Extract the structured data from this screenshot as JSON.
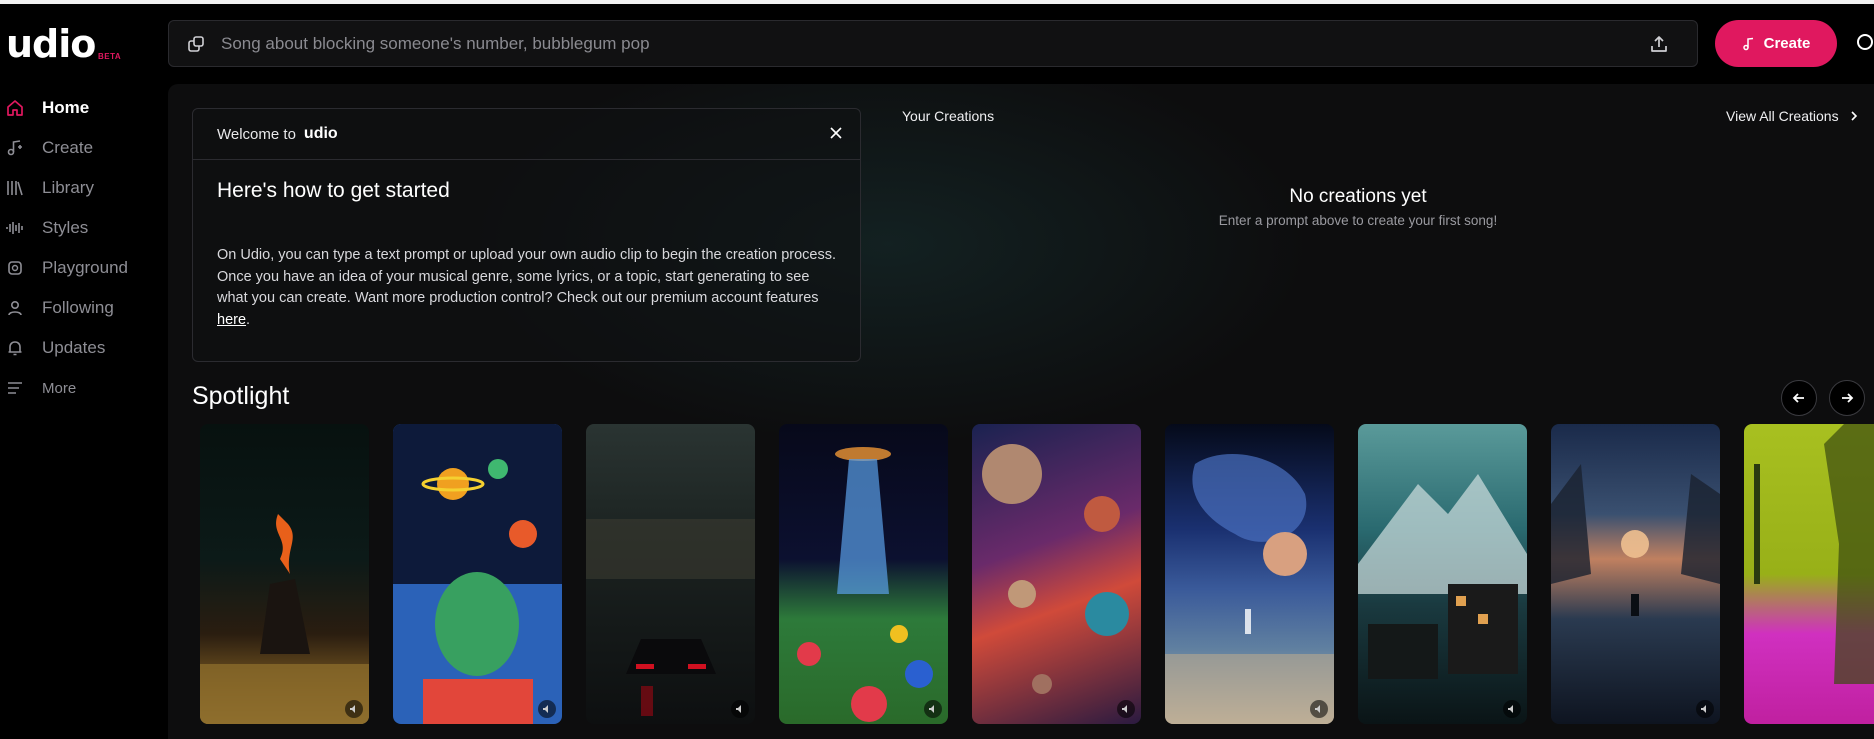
{
  "app": {
    "logo_text": "udio",
    "logo_badge": "BETA"
  },
  "sidebar": {
    "items": [
      {
        "label": "Home",
        "icon": "home-icon",
        "active": true
      },
      {
        "label": "Create",
        "icon": "music-note-icon",
        "active": false
      },
      {
        "label": "Library",
        "icon": "library-icon",
        "active": false
      },
      {
        "label": "Styles",
        "icon": "waveform-icon",
        "active": false
      },
      {
        "label": "Playground",
        "icon": "playground-icon",
        "active": false
      },
      {
        "label": "Following",
        "icon": "user-icon",
        "active": false
      },
      {
        "label": "Updates",
        "icon": "bell-icon",
        "active": false
      },
      {
        "label": "More",
        "icon": "menu-icon",
        "active": false
      }
    ]
  },
  "search": {
    "placeholder": "Song about blocking someone's number, bubblegum pop"
  },
  "header": {
    "create_label": "Create"
  },
  "welcome": {
    "prefix": "Welcome to",
    "brand": "udio",
    "title": "Here's how to get started",
    "body": "On Udio, you can type a text prompt or upload your own audio clip to begin the creation process. Once you have an idea of your musical genre, some lyrics, or a topic, start generating to see what you can create. Want more production control? Check out our premium account features ",
    "link": "here",
    "suffix": "."
  },
  "creations": {
    "title": "Your Creations",
    "view_all": "View All Creations",
    "empty_title": "No creations yet",
    "empty_sub": "Enter a prompt above to create your first song!"
  },
  "spotlight": {
    "title": "Spotlight",
    "cards": [
      {
        "name": "burning-rider-art"
      },
      {
        "name": "space-hair-girl-art"
      },
      {
        "name": "night-city-car-art"
      },
      {
        "name": "ufo-flower-field-art"
      },
      {
        "name": "planets-nebula-art"
      },
      {
        "name": "cosmic-beach-art"
      },
      {
        "name": "mountain-building-art"
      },
      {
        "name": "sunset-wanderer-art"
      },
      {
        "name": "neon-pink-cat-art"
      }
    ]
  },
  "colors": {
    "accent": "#e0185f",
    "background": "#000000",
    "panel": "#0d0d0e"
  }
}
